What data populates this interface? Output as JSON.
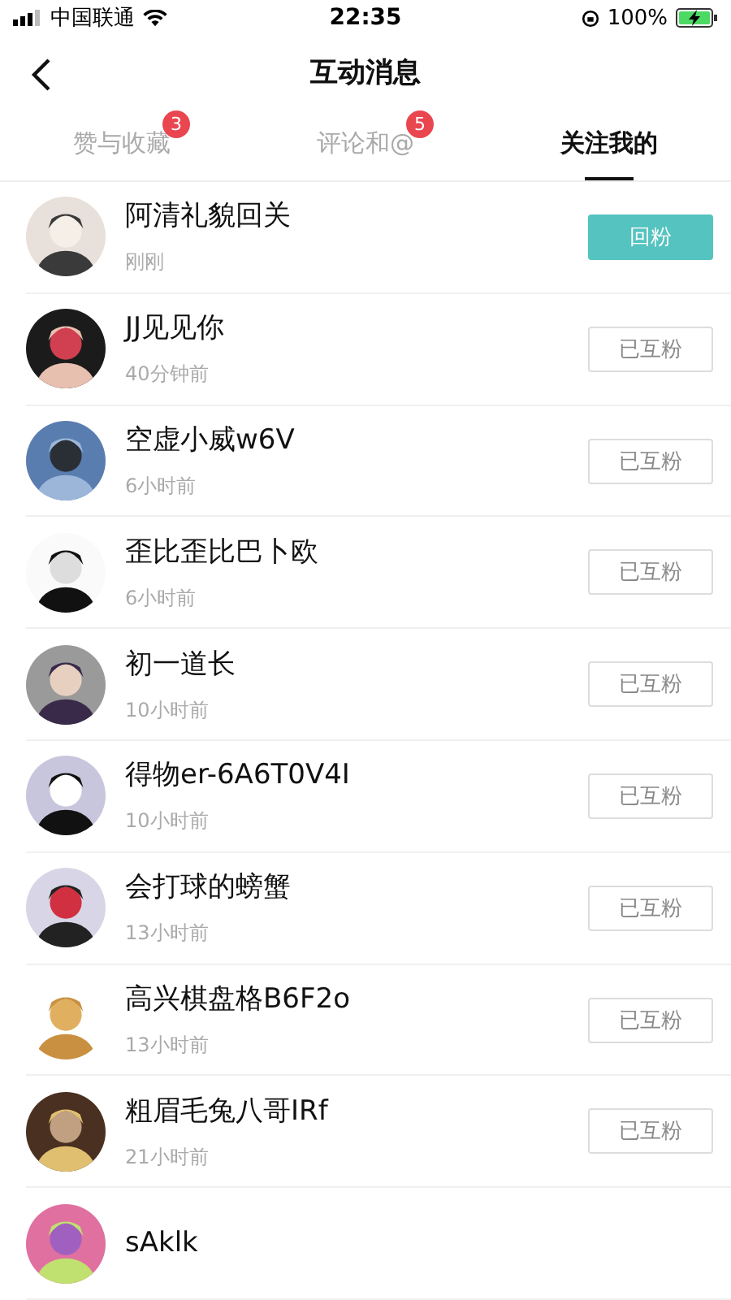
{
  "status_bar": {
    "carrier": "中国联通",
    "time": "22:35",
    "battery": "100%"
  },
  "nav": {
    "title": "互动消息"
  },
  "tabs": [
    {
      "label": "赞与收藏",
      "badge": "3",
      "selected": false
    },
    {
      "label": "评论和@",
      "badge": "5",
      "selected": false
    },
    {
      "label": "关注我的",
      "selected": true
    }
  ],
  "rows": [
    {
      "name": "阿清礼貌回关",
      "time": "刚刚",
      "button": {
        "label": "回粉",
        "kind": "follow_back"
      }
    },
    {
      "name": "JJ见见你",
      "time": "40分钟前",
      "button": {
        "label": "已互粉",
        "kind": "mutual"
      }
    },
    {
      "name": "空虚小威w6V",
      "time": "6小时前",
      "button": {
        "label": "已互粉",
        "kind": "mutual"
      }
    },
    {
      "name": "歪比歪比巴卜欧",
      "time": "6小时前",
      "button": {
        "label": "已互粉",
        "kind": "mutual"
      }
    },
    {
      "name": "初一道长",
      "time": "10小时前",
      "button": {
        "label": "已互粉",
        "kind": "mutual"
      }
    },
    {
      "name": "得物er-6A6T0V4I",
      "time": "10小时前",
      "button": {
        "label": "已互粉",
        "kind": "mutual"
      }
    },
    {
      "name": "会打球的螃蟹",
      "time": "13小时前",
      "button": {
        "label": "已互粉",
        "kind": "mutual"
      }
    },
    {
      "name": "高兴棋盘格B6F2o",
      "time": "13小时前",
      "button": {
        "label": "已互粉",
        "kind": "mutual"
      }
    },
    {
      "name": "粗眉毛兔八哥IRf",
      "time": "21小时前",
      "button": {
        "label": "已互粉",
        "kind": "mutual"
      }
    },
    {
      "name": "sAklk"
    }
  ]
}
